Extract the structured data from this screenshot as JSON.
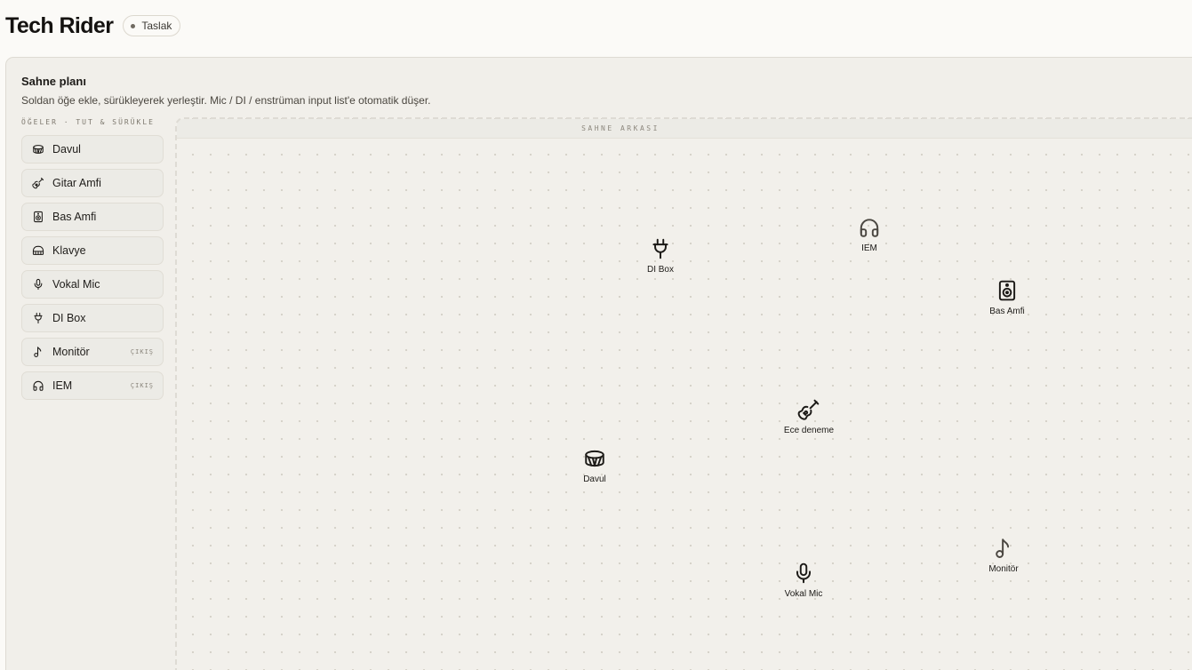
{
  "header": {
    "title": "Tech Rider",
    "status_badge": "Taslak"
  },
  "panel": {
    "title": "Sahne planı",
    "subtitle": "Soldan öğe ekle, sürükleyerek yerleştir. Mic / DI / enstrüman input list'e otomatik düşer.",
    "items_label": "ÖĞELER · TUT & SÜRÜKLE"
  },
  "palette": [
    {
      "label": "Davul",
      "icon": "drum-icon",
      "tag": ""
    },
    {
      "label": "Gitar Amfi",
      "icon": "guitar-icon",
      "tag": ""
    },
    {
      "label": "Bas Amfi",
      "icon": "speaker-icon",
      "tag": ""
    },
    {
      "label": "Klavye",
      "icon": "keyboard-icon",
      "tag": ""
    },
    {
      "label": "Vokal Mic",
      "icon": "microphone-icon",
      "tag": ""
    },
    {
      "label": "DI Box",
      "icon": "plug-icon",
      "tag": ""
    },
    {
      "label": "Monitör",
      "icon": "music-note-icon",
      "tag": "ÇIKIŞ"
    },
    {
      "label": "IEM",
      "icon": "headphones-icon",
      "tag": "ÇIKIŞ"
    }
  ],
  "stage": {
    "header_label": "SAHNE ARKASI",
    "placed": [
      {
        "label": "DI Box",
        "icon": "plug-icon"
      },
      {
        "label": "IEM",
        "icon": "headphones-icon"
      },
      {
        "label": "Bas Amfi",
        "icon": "speaker-icon"
      },
      {
        "label": "Ece deneme",
        "icon": "guitar-icon"
      },
      {
        "label": "Davul",
        "icon": "drum-icon"
      },
      {
        "label": "Monitör",
        "icon": "music-note-icon"
      },
      {
        "label": "Vokal Mic",
        "icon": "microphone-icon"
      }
    ]
  },
  "colors": {
    "background": "#fbfaf7",
    "panel": "#f1efea",
    "text": "#1c1a17"
  }
}
